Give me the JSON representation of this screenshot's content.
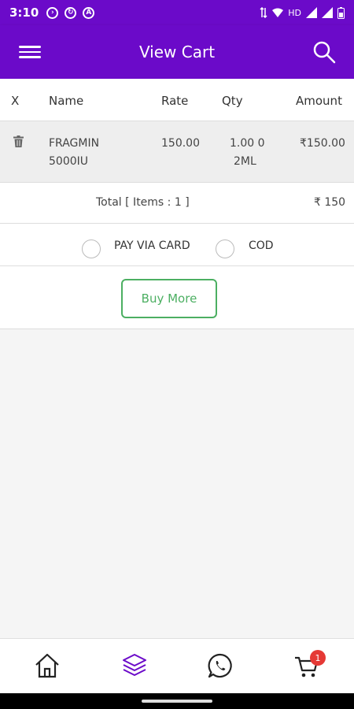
{
  "status_bar": {
    "time": "3:10",
    "network": "HD"
  },
  "app_bar": {
    "title": "View Cart",
    "menu_icon": "menu-icon",
    "search_icon": "search-icon"
  },
  "table": {
    "headers": {
      "remove": "X",
      "name": "Name",
      "rate": "Rate",
      "qty": "Qty",
      "amount": "Amount"
    },
    "rows": [
      {
        "name_line1": "FRAGMIN",
        "name_line2": "5000IU",
        "rate": "150.00",
        "qty_line1": "1.00 0",
        "qty_line2": "2ML",
        "amount": "₹150.00"
      }
    ]
  },
  "total": {
    "label": "Total [ Items : 1 ]",
    "value": "₹ 150"
  },
  "payment": {
    "option1": "PAY VIA CARD",
    "option2": "COD"
  },
  "buy_more": "Buy More",
  "bottom_nav": {
    "cart_badge": "1"
  },
  "colors": {
    "primary": "#6b0ac9",
    "accent_green": "#4caf62",
    "badge_red": "#e53935"
  }
}
